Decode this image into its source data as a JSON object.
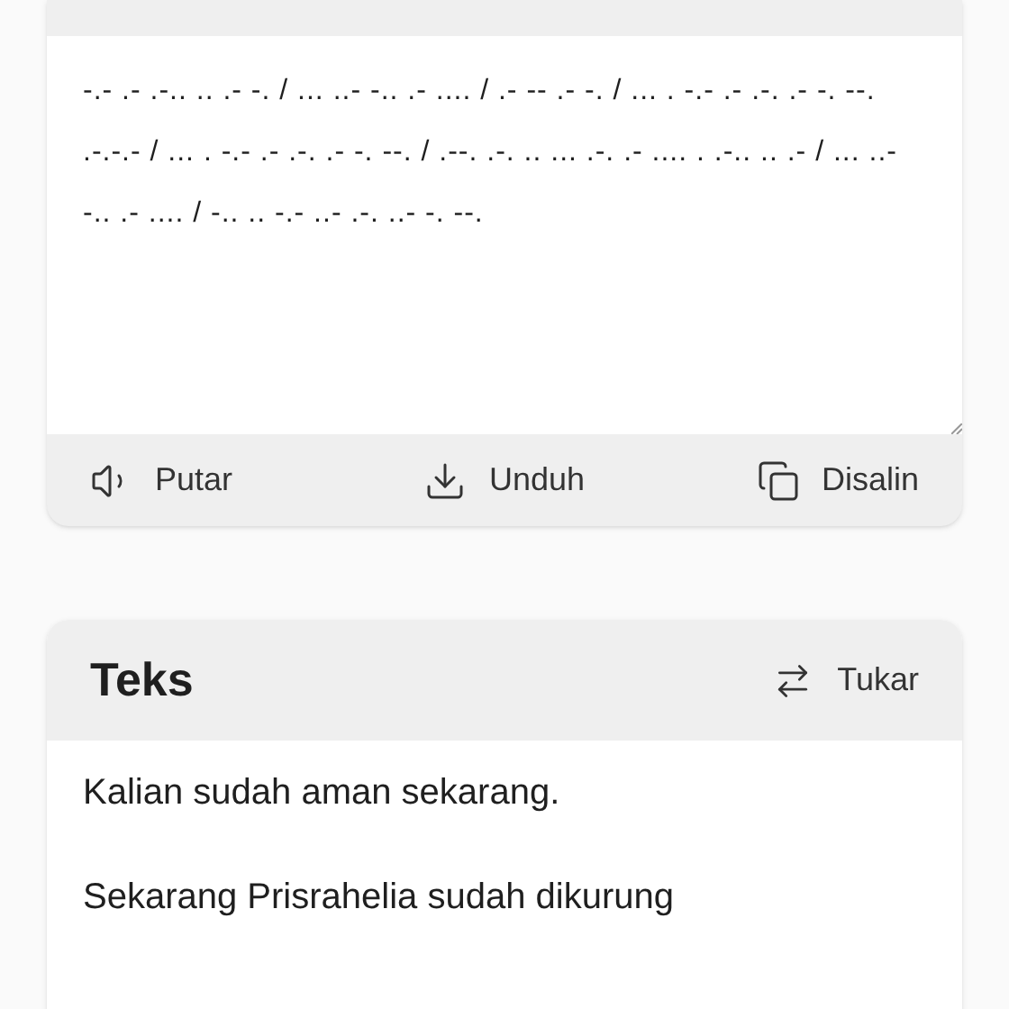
{
  "morse_card": {
    "output": "-.- .- .-.. .. .- -. / ... ..- -.. .- .... / .- -- .- -. / ... . -.- .- .-. .- -. --. .-.-.- / ... . -.- .- .-. .- -. --. / .--. .-. .. ... .-. .- .... . .-.. .. .- / ... ..- -.. .- .... / -.. .. -.- ..- .-. ..- -. --.",
    "actions": [
      {
        "kind": "play",
        "label": "Putar"
      },
      {
        "kind": "download",
        "label": "Unduh"
      },
      {
        "kind": "copy",
        "label": "Disalin"
      }
    ]
  },
  "text_card": {
    "title": "Teks",
    "swap_label": "Tukar",
    "paragraphs": [
      "Kalian sudah aman sekarang.",
      "Sekarang Prisrahelia sudah dikurung"
    ]
  }
}
